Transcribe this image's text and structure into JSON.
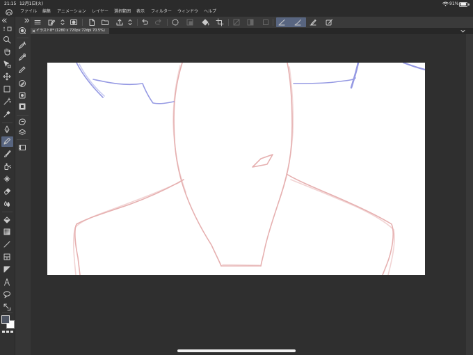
{
  "status": {
    "time": "21:15",
    "date": "12月1日(火)",
    "battery": "91%"
  },
  "menu": {
    "items": [
      "ファイル",
      "編集",
      "アニメーション",
      "レイヤー",
      "選択範囲",
      "表示",
      "フィルター",
      "ウィンドウ",
      "ヘルプ"
    ]
  },
  "canvas_tab": {
    "title": "イラスト8* (1280 x 720px 72dpi 70.5%)"
  },
  "icons": {
    "app": "app-logo-icon",
    "command_bar": [
      "menu-icon",
      "edit-document-icon",
      "switch-icon",
      "timelapse-icon",
      "new-file-icon",
      "open-folder-icon",
      "save-icon",
      "save-options-icon",
      "undo-icon",
      "redo-icon",
      "deselect-icon",
      "invert-selection-icon",
      "fill-selection-icon",
      "crop-icon",
      "clear-outside-icon",
      "convert-selection-icon",
      "show-selection-icon",
      "snap-ruler-icon",
      "snap-special-ruler-icon",
      "snap-grid-icon",
      "edit-canvas-icon"
    ],
    "tools": [
      "zoom-icon",
      "hand-icon",
      "operation-icon",
      "move-layer-icon",
      "selection-icon",
      "auto-select-icon",
      "eyedropper-icon",
      "pen-icon",
      "pencil-icon",
      "brush-icon",
      "airbrush-icon",
      "decoration-icon",
      "eraser-icon",
      "blend-icon",
      "fill-icon",
      "gradient-icon",
      "figure-icon",
      "frame-icon",
      "ruler-icon",
      "text-icon",
      "balloon-icon",
      "correct-line-icon"
    ],
    "subtools": [
      "subtool-menu-icon",
      "subtool-pencil-a-icon",
      "subtool-pencil-b-icon",
      "subtool-pencil-c-icon",
      "subtool-rough-pencil-icon",
      "subtool-pattern-icon",
      "subtool-square-icon",
      "subtool-blob-icon",
      "subtool-layers-icon",
      "subtool-tray-icon"
    ],
    "selected_tool": "pencil-icon"
  },
  "colors": {
    "app_background": "#2f2f2f",
    "panel": "#363636",
    "canvas": "#ffffff",
    "sketch_pink": "#e2a3a3",
    "sketch_blue": "#8a8fe0",
    "active_highlight": "#586580",
    "main_color": "#4e5563",
    "sub_color": "#ffffff"
  }
}
